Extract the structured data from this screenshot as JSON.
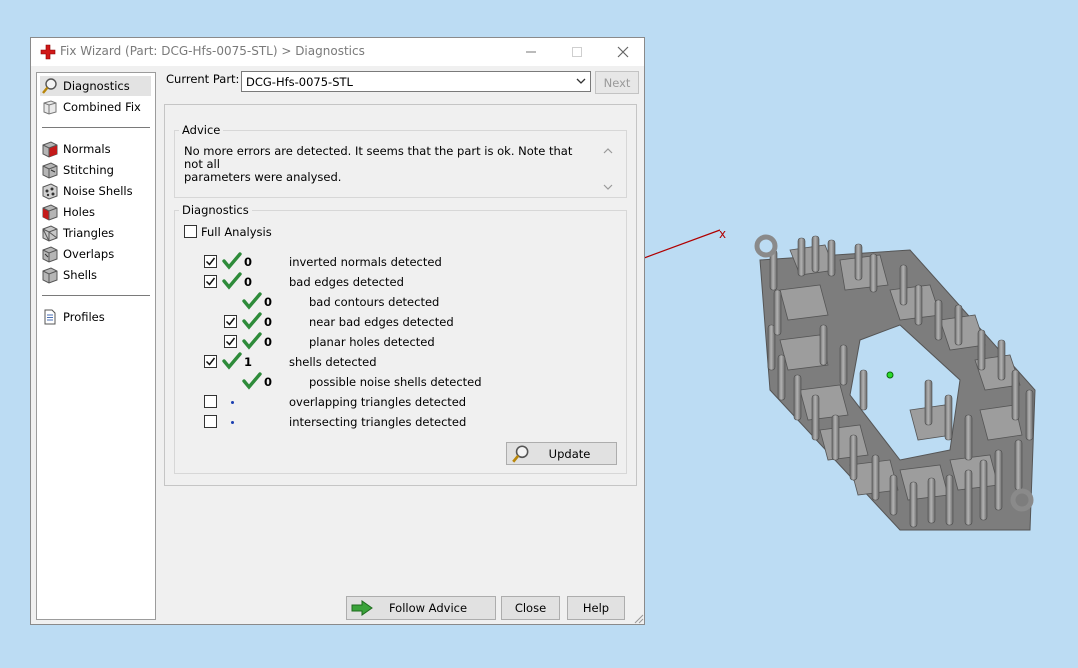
{
  "window": {
    "title": "Fix Wizard (Part: DCG-Hfs-0075-STL) > Diagnostics"
  },
  "sidebar": {
    "items": [
      {
        "label": "Diagnostics",
        "icon": "magnifier-icon"
      },
      {
        "label": "Combined Fix",
        "icon": "combined-fix-icon"
      },
      {
        "label": "Normals",
        "icon": "normals-cube-icon"
      },
      {
        "label": "Stitching",
        "icon": "stitching-cube-icon"
      },
      {
        "label": "Noise Shells",
        "icon": "noise-shells-icon"
      },
      {
        "label": "Holes",
        "icon": "holes-cube-icon"
      },
      {
        "label": "Triangles",
        "icon": "triangles-cube-icon"
      },
      {
        "label": "Overlaps",
        "icon": "overlaps-cube-icon"
      },
      {
        "label": "Shells",
        "icon": "shells-cube-icon"
      },
      {
        "label": "Profiles",
        "icon": "profiles-document-icon"
      }
    ]
  },
  "toolbar": {
    "current_part_label": "Current Part:",
    "current_part_value": "DCG-Hfs-0075-STL",
    "next_label": "Next"
  },
  "advice": {
    "title": "Advice",
    "line1": "No more errors are detected. It seems that the part is ok. Note that not all",
    "line2": "parameters were analysed."
  },
  "diagnostics": {
    "title": "Diagnostics",
    "full_analysis_label": "Full Analysis",
    "rows": [
      {
        "count": "0",
        "label": "inverted normals detected"
      },
      {
        "count": "0",
        "label": "bad edges detected"
      },
      {
        "count": "0",
        "label": "bad contours detected"
      },
      {
        "count": "0",
        "label": "near bad edges detected"
      },
      {
        "count": "0",
        "label": "planar holes detected"
      },
      {
        "count": "1",
        "label": "shells detected"
      },
      {
        "count": "0",
        "label": "possible noise shells detected"
      },
      {
        "count": "",
        "label": "overlapping triangles detected"
      },
      {
        "count": "",
        "label": "intersecting triangles detected"
      }
    ],
    "update_label": "Update"
  },
  "footer": {
    "follow_advice_label": "Follow Advice",
    "close_label": "Close",
    "help_label": "Help"
  },
  "viewport": {
    "axis_label": "x"
  },
  "colors": {
    "background": "#bcdcf3",
    "tick_green": "#2e8b3a",
    "axis_red": "#b00000",
    "model_gray": "#8c8c8c"
  }
}
